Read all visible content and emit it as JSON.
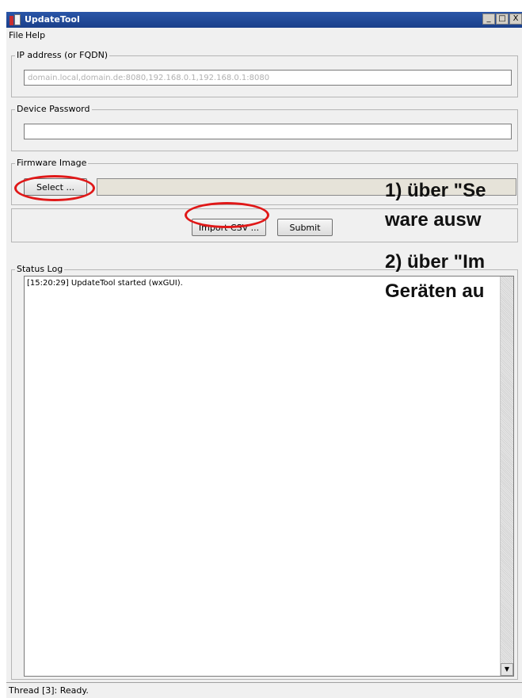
{
  "window": {
    "title": "UpdateTool"
  },
  "window_buttons": {
    "minimize": "_",
    "maximize": "□",
    "close": "X"
  },
  "menu": [
    {
      "label": "File"
    },
    {
      "label": "Help"
    }
  ],
  "ip": {
    "legend": "IP address (or FQDN)",
    "placeholder": "domain.local,domain.de:8080,192.168.0.1,192.168.0.1:8080"
  },
  "password": {
    "legend": "Device Password",
    "value": ""
  },
  "firmware": {
    "legend": "Firmware Image",
    "select_label": "Select ..."
  },
  "actions": {
    "import_label": "Import CSV ...",
    "submit_label": "Submit"
  },
  "log": {
    "legend": "Status Log",
    "lines": [
      "[15:20:29] UpdateTool started (wxGUI)."
    ]
  },
  "status": {
    "text": "Thread [3]: Ready."
  },
  "annotations": {
    "line1": "1) über \"Se",
    "line2": "ware ausw",
    "line3": "2) über \"Im",
    "line4": "Geräten au"
  },
  "colors": {
    "highlight": "#e01818",
    "titlebar": "#1a3f8a"
  }
}
